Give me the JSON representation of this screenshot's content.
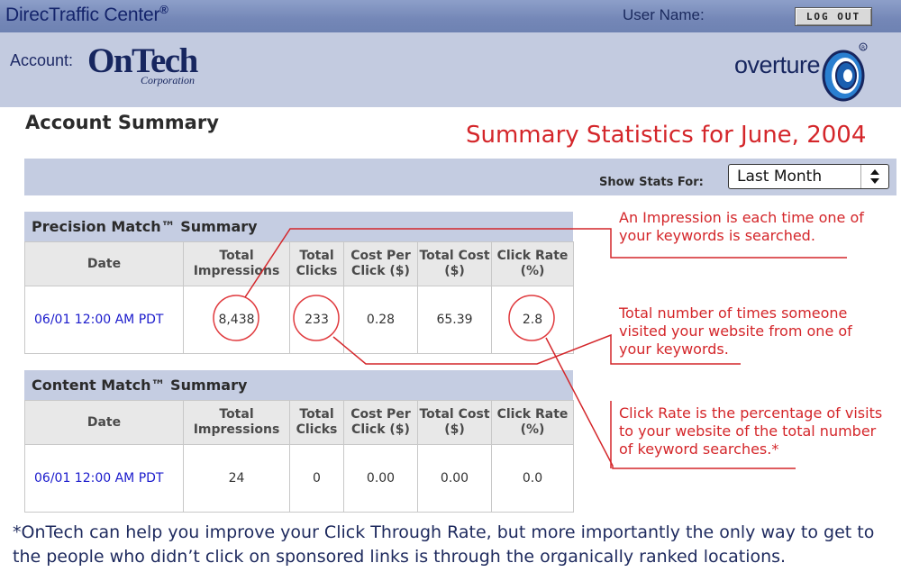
{
  "header": {
    "brand": "DirecTraffic Center",
    "brand_mark": "®",
    "user_label": "User Name:",
    "logout_label": "LOG OUT"
  },
  "account": {
    "label": "Account:",
    "logo_name": "OnTech",
    "logo_sub": "Corporation",
    "partner_logo_text": "overture"
  },
  "page": {
    "title": "Account Summary",
    "headline": "Summary Statistics for June, 2004",
    "show_stats_label": "Show Stats For:",
    "period_selected": "Last Month"
  },
  "columns": [
    "Date",
    "Total Impressions",
    "Total Clicks",
    "Cost Per Click ($)",
    "Total Cost ($)",
    "Click Rate (%)"
  ],
  "precision": {
    "title": "Precision Match™ Summary",
    "row": {
      "date": "06/01 12:00 AM PDT",
      "impressions": "8,438",
      "clicks": "233",
      "cpc": "0.28",
      "cost": "65.39",
      "rate": "2.8"
    }
  },
  "content": {
    "title": "Content Match™ Summary",
    "row": {
      "date": "06/01 12:00 AM PDT",
      "impressions": "24",
      "clicks": "0",
      "cpc": "0.00",
      "cost": "0.00",
      "rate": "0.0"
    }
  },
  "annotations": {
    "impression": [
      "An Impression is each time one of",
      "your keywords is searched."
    ],
    "clicks": [
      "Total number of times someone",
      "visited your website from one of",
      "your keywords."
    ],
    "click_rate": [
      "Click Rate is the percentage of visits",
      "to your website of the total number",
      "of keyword searches.*"
    ]
  },
  "footnote": "*OnTech can help you improve your Click Through Rate, but more importantly the only way to get to the people who didn’t click on sponsored links is through the organically ranked locations.",
  "colors": {
    "annotation_red": "#d4262a",
    "header_blue": "#7487b7",
    "navy": "#17265f",
    "date_link": "#1a1acc"
  }
}
